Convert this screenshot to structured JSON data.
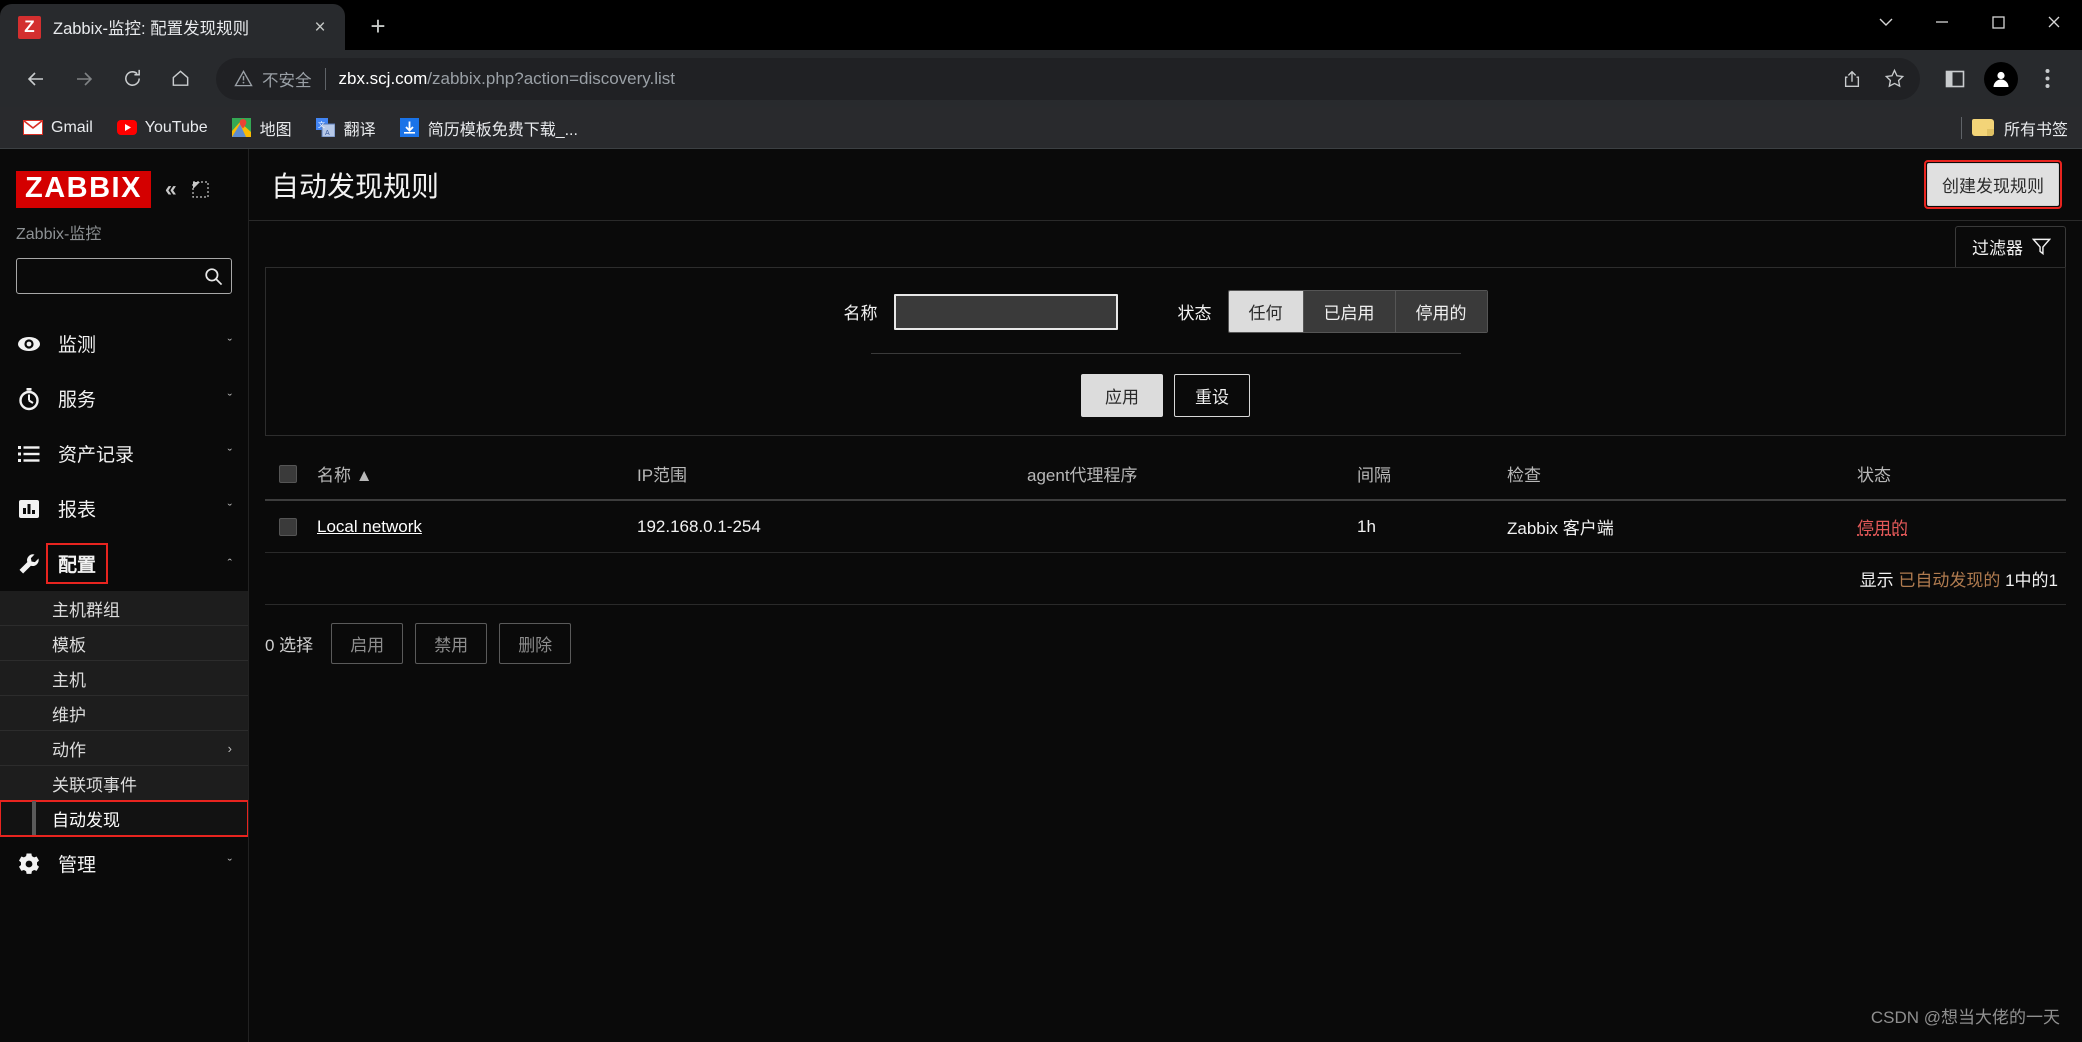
{
  "browser": {
    "tab": {
      "favicon_letter": "Z",
      "title": "Zabbix-监控: 配置发现规则",
      "close": "×"
    },
    "new_tab": "+",
    "window_controls": {
      "minimize": "minimize-icon",
      "maximize": "maximize-icon",
      "close": "close-icon",
      "more": "chevron-down-icon"
    },
    "omnibox": {
      "security_label": "不安全",
      "url_host": "zbx.scj.com",
      "url_path": "/zabbix.php?action=discovery.list"
    },
    "bookmarks": [
      {
        "label": "Gmail",
        "icon": "gmail-icon"
      },
      {
        "label": "YouTube",
        "icon": "youtube-icon"
      },
      {
        "label": "地图",
        "icon": "maps-icon"
      },
      {
        "label": "翻译",
        "icon": "translate-icon"
      },
      {
        "label": "简历模板免费下载_...",
        "icon": "download-icon"
      }
    ],
    "all_bookmarks": "所有书签"
  },
  "sidebar": {
    "logo": "ZABBIX",
    "server_name": "Zabbix-监控",
    "collapse_icon": "«",
    "search_value": "",
    "search_placeholder": "",
    "items": [
      {
        "label": "监测",
        "icon": "eye-icon",
        "caret": "ˇ",
        "expanded": false
      },
      {
        "label": "服务",
        "icon": "stopwatch-icon",
        "caret": "ˇ",
        "expanded": false
      },
      {
        "label": "资产记录",
        "icon": "list-icon",
        "caret": "ˇ",
        "expanded": false
      },
      {
        "label": "报表",
        "icon": "chart-bar-icon",
        "caret": "ˇ",
        "expanded": false
      },
      {
        "label": "配置",
        "icon": "wrench-icon",
        "caret": "ˆ",
        "expanded": true
      },
      {
        "label": "管理",
        "icon": "gear-icon",
        "caret": "ˇ",
        "expanded": false
      }
    ],
    "submenu": [
      {
        "label": "主机群组",
        "arrow": ""
      },
      {
        "label": "模板",
        "arrow": ""
      },
      {
        "label": "主机",
        "arrow": ""
      },
      {
        "label": "维护",
        "arrow": ""
      },
      {
        "label": "动作",
        "arrow": "›"
      },
      {
        "label": "关联项事件",
        "arrow": ""
      },
      {
        "label": "自动发现",
        "arrow": ""
      }
    ]
  },
  "page": {
    "title": "自动发现规则",
    "create_button": "创建发现规则",
    "filter_tab": "过滤器",
    "filter": {
      "name_label": "名称",
      "name_value": "",
      "status_label": "状态",
      "status_options": [
        "任何",
        "已启用",
        "停用的"
      ],
      "status_selected": "任何",
      "apply": "应用",
      "reset": "重设"
    },
    "table": {
      "columns": [
        "名称 ▲",
        "IP范围",
        "agent代理程序",
        "间隔",
        "检查",
        "状态"
      ],
      "rows": [
        {
          "name": "Local network",
          "ip_range": "192.168.0.1-254",
          "proxy": "",
          "interval": "1h",
          "checks": "Zabbix 客户端",
          "status": "停用的"
        }
      ],
      "footer_prefix": "显示",
      "footer_middle": "已自动发现的",
      "footer_count": "1中的1"
    },
    "actions": {
      "selected_text": "0 选择",
      "buttons": [
        "启用",
        "禁用",
        "删除"
      ]
    },
    "watermark": "CSDN @想当大佬的一天"
  },
  "colors": {
    "accent_red": "#d40000",
    "highlight_red": "#e8241f",
    "status_disabled": "#e45959"
  }
}
